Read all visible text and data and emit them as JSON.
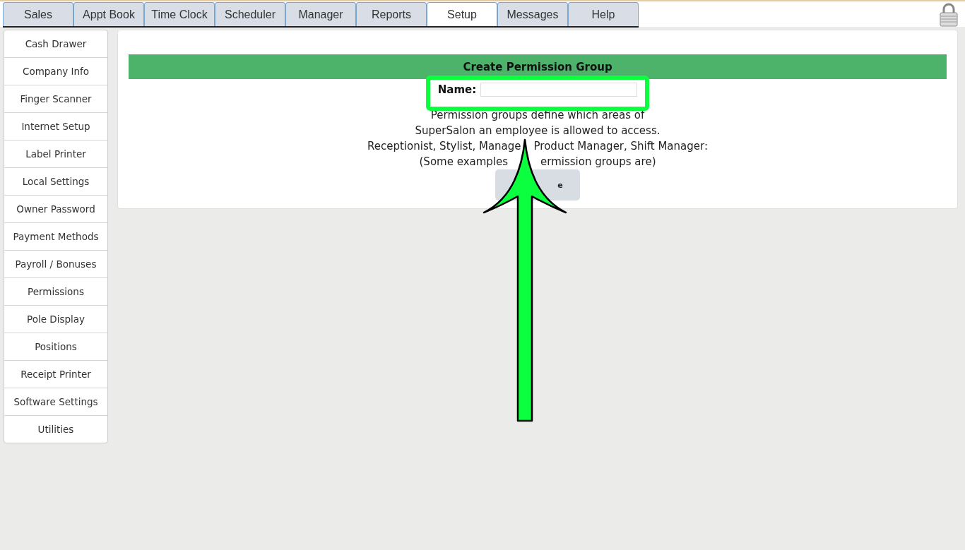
{
  "tabs": [
    {
      "label": "Sales",
      "selected": false
    },
    {
      "label": "Appt Book",
      "selected": false
    },
    {
      "label": "Time Clock",
      "selected": false
    },
    {
      "label": "Scheduler",
      "selected": false
    },
    {
      "label": "Manager",
      "selected": false
    },
    {
      "label": "Reports",
      "selected": false
    },
    {
      "label": "Setup",
      "selected": true
    },
    {
      "label": "Messages",
      "selected": false
    },
    {
      "label": "Help",
      "selected": false
    }
  ],
  "sidebar": {
    "items": [
      "Cash Drawer",
      "Company Info",
      "Finger Scanner",
      "Internet Setup",
      "Label Printer",
      "Local Settings",
      "Owner Password",
      "Payment Methods",
      "Payroll / Bonuses",
      "Permissions",
      "Pole Display",
      "Positions",
      "Receipt Printer",
      "Software Settings",
      "Utilities"
    ]
  },
  "panel": {
    "title": "Create Permission Group",
    "name_label": "Name:",
    "description": [
      [
        "Permission groups define which areas of"
      ],
      [
        "SuperSalon an employee is allowed to access."
      ],
      [
        "Receptionist, Stylist, Manage",
        "Product Manager, Shift Manager:"
      ],
      [
        "(Some examples",
        "ermission groups are)"
      ]
    ],
    "button": "e"
  }
}
